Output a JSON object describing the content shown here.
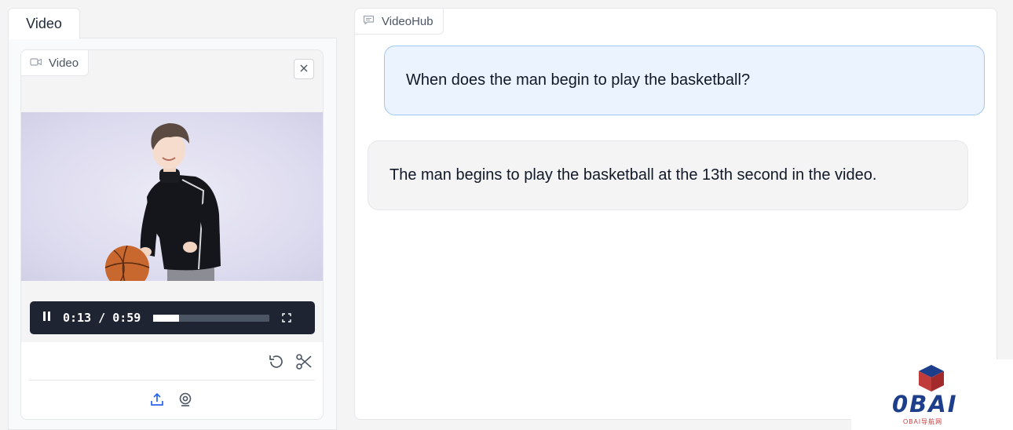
{
  "left_tab": {
    "label": "Video"
  },
  "video_component": {
    "badge_label": "Video",
    "player": {
      "current_time": "0:13",
      "separator": "/",
      "duration": "0:59",
      "progress_fraction": 0.22
    }
  },
  "chatbot": {
    "badge_label": "VideoHub",
    "messages": [
      {
        "role": "user",
        "text": "When does the man begin to play the basketball?"
      },
      {
        "role": "bot",
        "text": "The man begins to play the basketball at the 13th second in the video."
      }
    ]
  },
  "watermark": {
    "logo": "0BAI",
    "subtitle": "OBAI导航网"
  },
  "colors": {
    "user_bubble": "#eaf3ff",
    "user_border": "#9fc8f0",
    "bot_bubble": "#f4f4f5",
    "player_bar": "#1f2433",
    "watermark_blue": "#1d3e8a",
    "watermark_red": "#c23b3b"
  },
  "icons": [
    "video-camera-icon",
    "close-icon",
    "pause-icon",
    "fullscreen-icon",
    "undo-icon",
    "scissors-icon",
    "upload-icon",
    "webcam-icon",
    "chat-icon",
    "cube-logo-icon"
  ]
}
